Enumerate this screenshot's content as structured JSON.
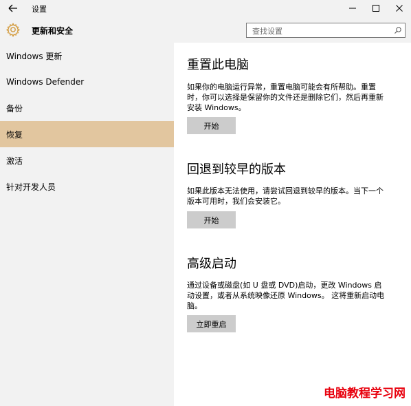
{
  "titlebar": {
    "title": "设置"
  },
  "header": {
    "section_title": "更新和安全",
    "search_placeholder": "查找设置"
  },
  "sidebar": {
    "items": [
      {
        "label": "Windows 更新"
      },
      {
        "label": "Windows Defender"
      },
      {
        "label": "备份"
      },
      {
        "label": "恢复",
        "active": true
      },
      {
        "label": "激活"
      },
      {
        "label": "针对开发人员"
      }
    ]
  },
  "main": {
    "sections": [
      {
        "heading": "重置此电脑",
        "lines": [
          "如果你的电脑运行异常，重置电脑可能会有所帮助。重置",
          "时，你可以选择是保留你的文件还是删除它们，然后再重新",
          "安装 Windows。"
        ],
        "button": "开始"
      },
      {
        "heading": "回退到较早的版本",
        "lines": [
          "如果此版本无法使用，请尝试回退到较早的版本。当下一个",
          "版本可用时，我们会安装它。"
        ],
        "button": "开始"
      },
      {
        "heading": "高级启动",
        "lines": [
          "通过设备或磁盘(如 U 盘或 DVD)启动，更改 Windows 启",
          "动设置，或者从系统映像还原 Windows。 这将重新启动电",
          "脑。"
        ],
        "button": "立即重启"
      }
    ]
  },
  "watermark": {
    "text": "电脑教程学习网"
  },
  "colors": {
    "active_item": "#e2c69f",
    "accent_gear": "#d39a3b",
    "watermark": "#e8000d"
  }
}
